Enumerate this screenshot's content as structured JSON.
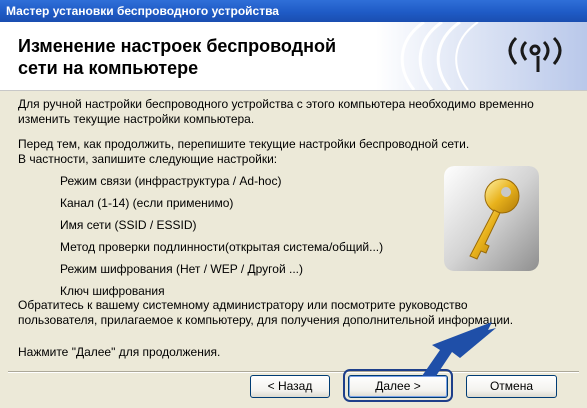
{
  "window": {
    "title": "Мастер установки беспроводного устройства"
  },
  "banner": {
    "title_line1": "Изменение настроек беспроводной",
    "title_line2": "сети на компьютере",
    "icon": "wireless-signal-icon"
  },
  "content": {
    "intro_line1": "Для ручной настройки беспроводного устройства с этого компьютера необходимо временно",
    "intro_line2": "изменить текущие настройки компьютера.",
    "before_line1": "Перед тем, как продолжить, перепишите текущие настройки беспроводной сети.",
    "before_line2": "В частности, запишите следующие настройки:",
    "settings": [
      "Режим связи (инфраструктура / Ad-hoc)",
      "Канал (1-14) (если применимо)",
      "Имя сети (SSID / ESSID)",
      "Метод проверки подлинности(открытая система/общий...)",
      "Режим шифрования (Нет / WEP / Другой ...)",
      "Ключ шифрования"
    ],
    "contact_line1": "Обратитесь к вашему системному администратору или посмотрите руководство",
    "contact_line2": "пользователя, прилагаемое к компьютеру, для получения дополнительной информации.",
    "continue_text": "Нажмите \"Далее\" для продолжения."
  },
  "buttons": {
    "back": "< Назад",
    "next": "Далее >",
    "cancel": "Отмена"
  },
  "colors": {
    "titlebar": "#1f5bc6",
    "dialog_bg": "#ece9d8",
    "arrow": "#1f4fa8",
    "key": "#e8b21c"
  }
}
